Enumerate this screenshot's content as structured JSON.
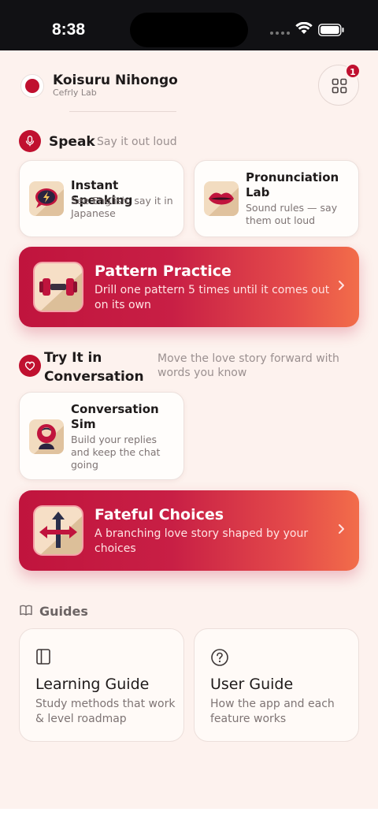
{
  "status": {
    "time": "8:38"
  },
  "header": {
    "app_name": "Koisuru Nihongo",
    "app_sub": "Cefrly Lab",
    "badge_count": "1"
  },
  "speak": {
    "title": "Speak",
    "hint": "Say it out loud",
    "cards": [
      {
        "title": "Instant Speaking",
        "desc": "See English, say it in Japanese"
      },
      {
        "title": "Pronunciation Lab",
        "desc": "Sound rules — say them out loud"
      }
    ],
    "hero": {
      "title": "Pattern Practice",
      "desc": "Drill one pattern 5 times until it comes out on its own"
    }
  },
  "conversation": {
    "title": "Try It in Conversation",
    "hint": "Move the love story forward with words you know",
    "cards": [
      {
        "title": "Conversation Sim",
        "desc": "Build your replies and keep the chat going"
      }
    ],
    "hero": {
      "title": "Fateful Choices",
      "desc": "A branching love story shaped by your choices"
    }
  },
  "guides": {
    "title": "Guides",
    "cards": [
      {
        "title": "Learning Guide",
        "desc": "Study methods that work & level roadmap"
      },
      {
        "title": "User Guide",
        "desc": "How the app and each feature works"
      }
    ]
  },
  "colors": {
    "accent": "#c0102f",
    "background": "#fdf2ee"
  }
}
